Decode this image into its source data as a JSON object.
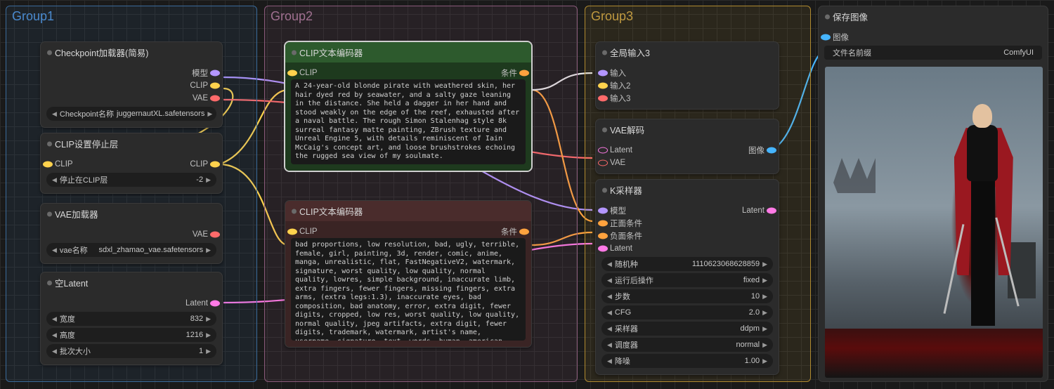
{
  "groups": {
    "g1": "Group1",
    "g2": "Group2",
    "g3": "Group3"
  },
  "checkpoint": {
    "title": "Checkpoint加载器(简易)",
    "out_model": "模型",
    "out_clip": "CLIP",
    "out_vae": "VAE",
    "widget_label": "Checkpoint名称",
    "widget_value": "juggernautXL.safetensors"
  },
  "clip_stop": {
    "title": "CLIP设置停止层",
    "in_clip": "CLIP",
    "out_clip": "CLIP",
    "widget_label": "停止在CLIP层",
    "widget_value": "-2"
  },
  "vae_loader": {
    "title": "VAE加载器",
    "out_vae": "VAE",
    "widget_label": "vae名称",
    "widget_value": "sdxl_zhamao_vae.safetensors"
  },
  "empty_latent": {
    "title": "空Latent",
    "out_latent": "Latent",
    "w_label": "宽度",
    "w_val": "832",
    "h_label": "高度",
    "h_val": "1216",
    "b_label": "批次大小",
    "b_val": "1"
  },
  "clip_pos": {
    "title": "CLIP文本编码器",
    "in_clip": "CLIP",
    "out_cond": "条件",
    "text": "A 24-year-old blonde pirate with weathered skin, her hair dyed red by seawater, and a salty gaze leaning in the distance. She held a dagger in her hand and stood weakly on the edge of the reef, exhausted after a naval battle. The rough Simon Stalenhag style 8k surreal fantasy matte painting, ZBrush texture and Unreal Engine 5, with details reminiscent of Iain McCaig's concept art, and loose brushstrokes echoing the rugged sea view of my soulmate."
  },
  "clip_neg": {
    "title": "CLIP文本编码器",
    "in_clip": "CLIP",
    "out_cond": "条件",
    "text": "bad proportions, low resolution, bad, ugly, terrible, female, girl, painting, 3d, render, comic, anime, manga, unrealistic, flat, FastNegativeV2, watermark, signature, worst quality, low quality, normal quality, lowres, simple background, inaccurate limb, extra fingers, fewer fingers, missing fingers, extra arms, (extra legs:1.3), inaccurate eyes, bad composition, bad anatomy, error, extra digit, fewer digits, cropped, low res, worst quality, low quality, normal quality, jpeg artifacts, extra digit, fewer digits, trademark, watermark, artist's name, username, signature, text, words, human, american flag, muscular"
  },
  "global_in": {
    "title": "全局输入3",
    "in1": "输入",
    "in2": "输入2",
    "in3": "输入3"
  },
  "vae_decode": {
    "title": "VAE解码",
    "in_latent": "Latent",
    "in_vae": "VAE",
    "out_image": "图像"
  },
  "ksampler": {
    "title": "K采样器",
    "in_model": "模型",
    "out_latent": "Latent",
    "in_pos": "正面条件",
    "in_neg": "负面条件",
    "in_latent": "Latent",
    "seed_label": "随机种",
    "seed_val": "1110623068628859",
    "after_label": "运行后操作",
    "after_val": "fixed",
    "steps_label": "步数",
    "steps_val": "10",
    "cfg_label": "CFG",
    "cfg_val": "2.0",
    "sampler_label": "采样器",
    "sampler_val": "ddpm",
    "sched_label": "调度器",
    "sched_val": "normal",
    "denoise_label": "降噪",
    "denoise_val": "1.00"
  },
  "save": {
    "title": "保存图像",
    "in_image": "图像",
    "prefix_label": "文件名前缀",
    "prefix_val": "ComfyUI"
  },
  "colors": {
    "model": "#b396ff",
    "clip": "#ffd24d",
    "vae": "#ff6a6a",
    "latent": "#ff7ae6",
    "cond": "#ffa23e",
    "image": "#46b5ff",
    "white": "#e8e8e8"
  }
}
